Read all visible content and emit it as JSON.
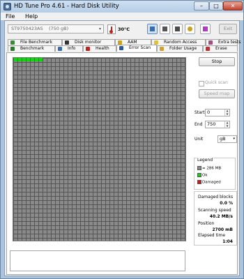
{
  "window": {
    "title": "HD Tune Pro 4.61 - Hard Disk Utility",
    "min_glyph": "–",
    "max_glyph": "□",
    "close_glyph": "✕"
  },
  "menu": {
    "file": "File",
    "help": "Help"
  },
  "toolbar": {
    "drive_model": "ST9750423AS",
    "drive_size": "(750 gB)",
    "dropdown_arrow": "▾",
    "temperature": "30°C",
    "icons": [
      "copy-info-icon",
      "copy-screen-icon",
      "save-icon",
      "options-icon",
      "help-icon"
    ],
    "exit_label": "Exit"
  },
  "tabs": {
    "row1": [
      {
        "label": "File Benchmark",
        "icon": "file-benchmark-icon",
        "color": "#3a8a3a"
      },
      {
        "label": "Disk monitor",
        "icon": "disk-monitor-icon",
        "color": "#333333"
      },
      {
        "label": "AAM",
        "icon": "aam-icon",
        "color": "#d0a020"
      },
      {
        "label": "Random Access",
        "icon": "random-access-icon",
        "color": "#e0c040"
      },
      {
        "label": "Extra tests",
        "icon": "extra-tests-icon",
        "color": "#a0507a"
      }
    ],
    "row2": [
      {
        "label": "Benchmark",
        "icon": "benchmark-icon",
        "color": "#2a7a2a"
      },
      {
        "label": "Info",
        "icon": "info-icon",
        "color": "#3a6ab0"
      },
      {
        "label": "Health",
        "icon": "health-icon",
        "color": "#c02020"
      },
      {
        "label": "Error Scan",
        "icon": "error-scan-icon",
        "color": "#2a5a9a",
        "active": true
      },
      {
        "label": "Folder Usage",
        "icon": "folder-usage-icon",
        "color": "#d0a030"
      },
      {
        "label": "Erase",
        "icon": "erase-icon",
        "color": "#c03030"
      }
    ]
  },
  "scan": {
    "grid_columns": 41,
    "grid_rows": 44,
    "ok_blocks": 7
  },
  "side": {
    "stop_label": "Stop",
    "quick_scan_label": "Quick scan",
    "speed_map_label": "Speed map",
    "start_label": "Start",
    "start_value": "0",
    "end_label": "End",
    "end_value": "750",
    "unit_label": "Unit",
    "unit_value": "gB",
    "legend_title": "Legend",
    "legend": [
      {
        "label": "= 286 MB",
        "color": "#8a8a8a"
      },
      {
        "label": "Ok",
        "color": "#17d117"
      },
      {
        "label": "Damaged",
        "color": "#d01818"
      }
    ],
    "damaged_label": "Damaged blocks",
    "damaged_value": "0.0 %",
    "speed_label": "Scanning speed",
    "speed_value": "40.2 MB/s",
    "position_label": "Position",
    "position_value": "2700 mB",
    "elapsed_label": "Elapsed time",
    "elapsed_value": "1:04"
  }
}
